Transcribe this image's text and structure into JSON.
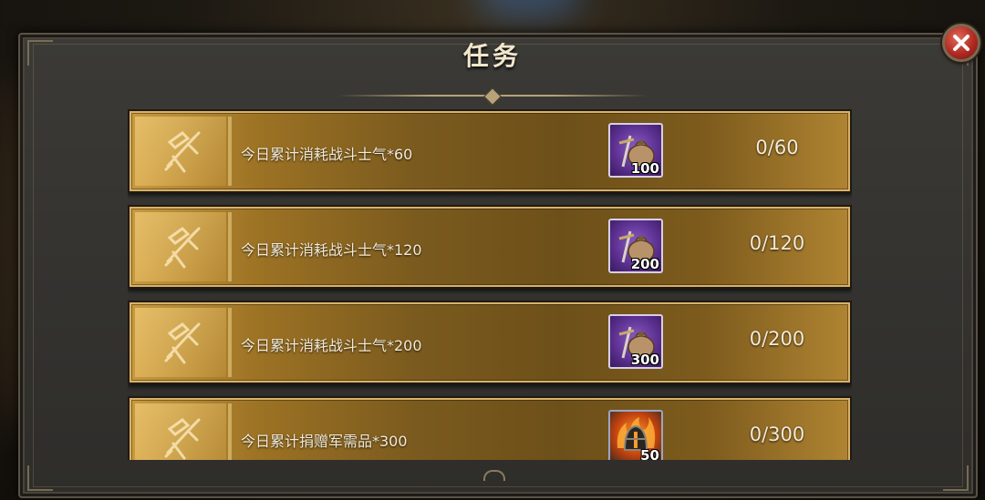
{
  "title": "任务",
  "close_icon": "close-icon",
  "tasks": [
    {
      "text": "今日累计消耗战斗士气*60",
      "reward_icon": "bag-sword-icon",
      "reward_qty": "100",
      "progress": "0/60",
      "reward_color": "#6a3fa6"
    },
    {
      "text": "今日累计消耗战斗士气*120",
      "reward_icon": "bag-sword-icon",
      "reward_qty": "200",
      "progress": "0/120",
      "reward_color": "#6a3fa6"
    },
    {
      "text": "今日累计消耗战斗士气*200",
      "reward_icon": "bag-sword-icon",
      "reward_qty": "300",
      "progress": "0/200",
      "reward_color": "#6a3fa6"
    },
    {
      "text": "今日累计捐赠军需品*300",
      "reward_icon": "flaming-helmet-icon",
      "reward_qty": "50",
      "progress": "0/300",
      "reward_color": "#c2420e"
    }
  ],
  "task_icon": "sword-scroll-icon",
  "colors": {
    "row_gold": "#9c7224",
    "text": "#f3ead6",
    "close_red": "#b22a22"
  }
}
